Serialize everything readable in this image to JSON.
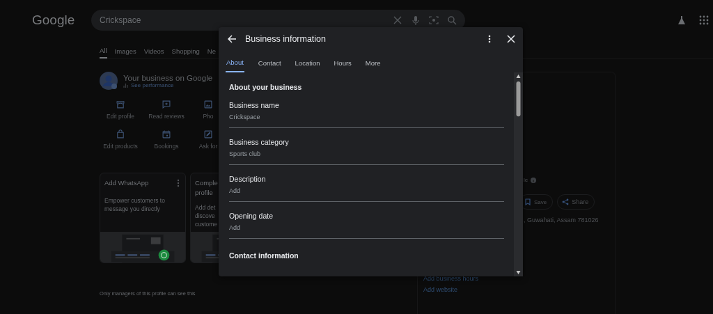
{
  "header": {
    "logo": "Google",
    "search": {
      "value": "Crickspace"
    }
  },
  "search_tabs": [
    {
      "label": "All",
      "selected": true
    },
    {
      "label": "Images",
      "selected": false
    },
    {
      "label": "Videos",
      "selected": false
    },
    {
      "label": "Shopping",
      "selected": false
    },
    {
      "label": "Ne",
      "selected": false
    }
  ],
  "business_panel": {
    "title": "Your business on Google",
    "link": "See performance",
    "actions": [
      {
        "label": "Edit profile"
      },
      {
        "label": "Read reviews"
      },
      {
        "label": "Pho"
      },
      {
        "label": "Edit products"
      },
      {
        "label": "Bookings"
      },
      {
        "label": "Ask for"
      }
    ],
    "cards": [
      {
        "kind": "promo",
        "title_lines": [
          "Add WhatsApp"
        ],
        "text_lines": [
          "Empower customers to",
          "message you directly"
        ],
        "menu": true
      },
      {
        "kind": "promo",
        "title_lines": [
          "Comple",
          "profile"
        ],
        "text_lines": [
          "Add det",
          "discove",
          "custome"
        ],
        "menu": false
      }
    ],
    "footnote": "Only managers of this profile can see this"
  },
  "profile_panel": {
    "rating_label": "le",
    "save": "Save",
    "share": "Share",
    "address": ", Guwahati, Assam 781026",
    "links": [
      "Add business hours",
      "Add website"
    ]
  },
  "dialog": {
    "title": "Business information",
    "tabs": [
      {
        "label": "About",
        "selected": true
      },
      {
        "label": "Contact",
        "selected": false
      },
      {
        "label": "Location",
        "selected": false
      },
      {
        "label": "Hours",
        "selected": false
      },
      {
        "label": "More",
        "selected": false
      }
    ],
    "sections": [
      {
        "heading": "About your business",
        "fields": [
          {
            "label": "Business name",
            "value": "Crickspace"
          },
          {
            "label": "Business category",
            "value": "Sports club"
          },
          {
            "label": "Description",
            "value": "Add"
          },
          {
            "label": "Opening date",
            "value": "Add"
          }
        ]
      },
      {
        "heading": "Contact information"
      }
    ]
  }
}
